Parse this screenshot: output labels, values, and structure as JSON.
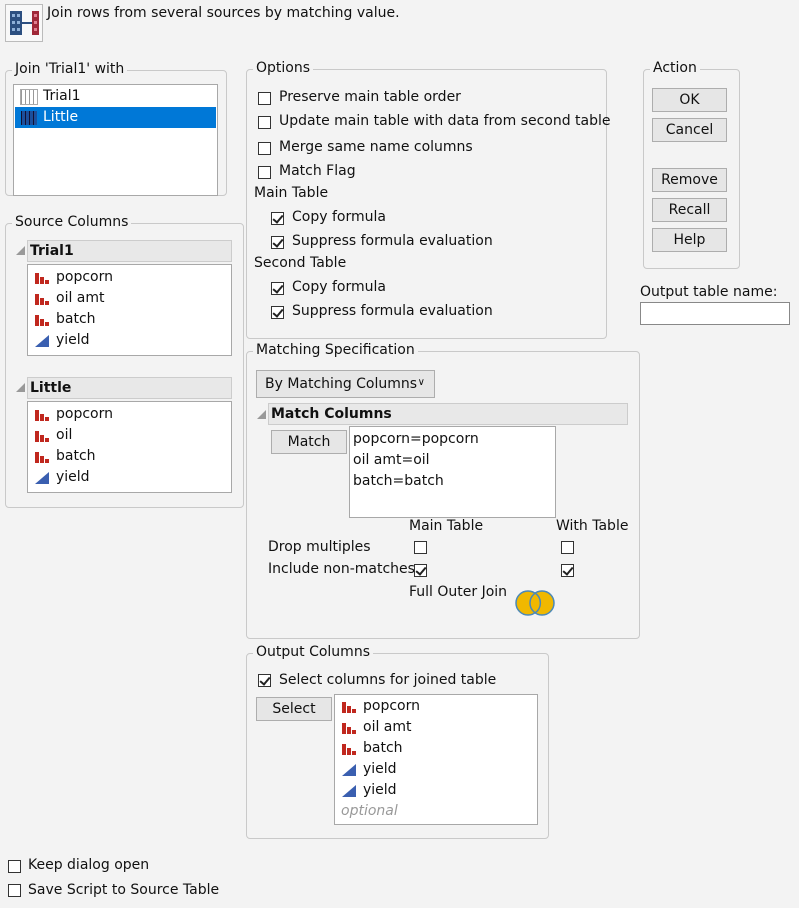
{
  "header": {
    "description": "Join rows from several sources by matching value.",
    "icon": "join-icon"
  },
  "join_with": {
    "title": "Join 'Trial1' with",
    "tables": [
      {
        "label": "Trial1",
        "selected": false
      },
      {
        "label": "Little",
        "selected": true
      }
    ]
  },
  "source_columns": {
    "title": "Source Columns",
    "tables": [
      {
        "name": "Trial1",
        "columns": [
          {
            "label": "popcorn",
            "type": "nominal"
          },
          {
            "label": "oil amt",
            "type": "nominal"
          },
          {
            "label": "batch",
            "type": "nominal"
          },
          {
            "label": "yield",
            "type": "continuous"
          }
        ]
      },
      {
        "name": "Little",
        "columns": [
          {
            "label": "popcorn",
            "type": "nominal"
          },
          {
            "label": "oil",
            "type": "nominal"
          },
          {
            "label": "batch",
            "type": "nominal"
          },
          {
            "label": "yield",
            "type": "continuous"
          }
        ]
      }
    ]
  },
  "options": {
    "title": "Options",
    "items": [
      {
        "label": "Preserve main table order",
        "checked": false
      },
      {
        "label": "Update main table with data from second table",
        "checked": false
      },
      {
        "label": "Merge same name columns",
        "checked": false
      },
      {
        "label": "Match Flag",
        "checked": false
      }
    ],
    "main_table": {
      "label": "Main Table",
      "items": [
        {
          "label": "Copy formula",
          "checked": true
        },
        {
          "label": "Suppress formula evaluation",
          "checked": true
        }
      ]
    },
    "second_table": {
      "label": "Second Table",
      "items": [
        {
          "label": "Copy formula",
          "checked": true
        },
        {
          "label": "Suppress formula evaluation",
          "checked": true
        }
      ]
    }
  },
  "action": {
    "title": "Action",
    "buttons": [
      "OK",
      "Cancel",
      "Remove",
      "Recall",
      "Help"
    ]
  },
  "output_table": {
    "label": "Output table name:",
    "value": ""
  },
  "matching": {
    "title": "Matching Specification",
    "method": "By Matching Columns",
    "match_columns_title": "Match Columns",
    "match_button": "Match",
    "pairs": [
      "popcorn=popcorn",
      "oil amt=oil",
      "batch=batch"
    ],
    "main_table_label": "Main Table",
    "with_table_label": "With Table",
    "drop_multiples": {
      "label": "Drop multiples",
      "main": false,
      "with": false
    },
    "include_nonmatches": {
      "label": "Include non-matches",
      "main": true,
      "with": true
    },
    "join_type": "Full Outer Join",
    "venn_color": "#f0b800"
  },
  "output_columns": {
    "title": "Output Columns",
    "select_all": {
      "label": "Select columns for joined table",
      "checked": true
    },
    "select_button": "Select",
    "columns": [
      {
        "label": "popcorn",
        "type": "nominal"
      },
      {
        "label": "oil amt",
        "type": "nominal"
      },
      {
        "label": "batch",
        "type": "nominal"
      },
      {
        "label": "yield",
        "type": "continuous"
      },
      {
        "label": "yield",
        "type": "continuous"
      }
    ],
    "placeholder": "optional"
  },
  "footer": {
    "keep_open": {
      "label": "Keep dialog open",
      "checked": false
    },
    "save_script": {
      "label": "Save Script to Source Table",
      "checked": false
    }
  },
  "colors": {
    "selection": "#0078d7",
    "nominal": "#c0281e",
    "continuous": "#3a5fb0"
  }
}
